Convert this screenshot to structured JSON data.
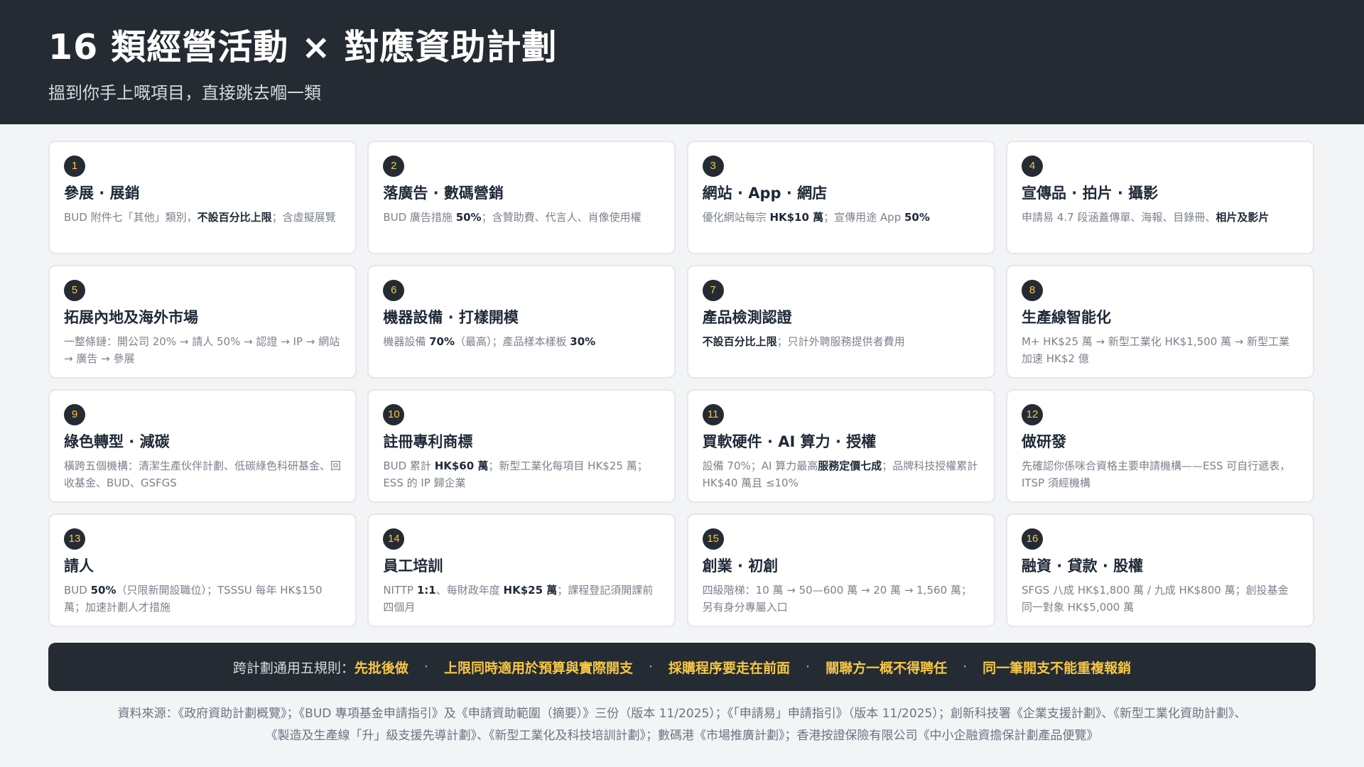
{
  "header": {
    "title": "16 類經營活動 × 對應資助計劃",
    "subtitle": "搵到你手上嘅項目，直接跳去嗰一類"
  },
  "cards": [
    {
      "num": "1",
      "title": "參展 · 展銷",
      "desc": [
        "BUD 附件七「其他」類別，",
        {
          "b": "不設百分比上限"
        },
        "；含虛擬展覽"
      ]
    },
    {
      "num": "2",
      "title": "落廣告 · 數碼營銷",
      "desc": [
        "BUD 廣告措施 ",
        {
          "b": "50%"
        },
        "；含贊助費、代言人、肖像使用權"
      ]
    },
    {
      "num": "3",
      "title": "網站 · App · 網店",
      "desc": [
        "優化網站每宗 ",
        {
          "b": "HK$10 萬"
        },
        "；宣傳用途 App ",
        {
          "b": "50%"
        }
      ]
    },
    {
      "num": "4",
      "title": "宣傳品 · 拍片 · 攝影",
      "desc": [
        "申請易 4.7 段涵蓋傳單、海報、目錄冊、",
        {
          "b": "相片及影片"
        }
      ]
    },
    {
      "num": "5",
      "title": "拓展內地及海外市場",
      "desc": [
        "一整條鏈：開公司 20% → 請人 50% → 認證 → IP → 網站 → 廣告 → 參展"
      ]
    },
    {
      "num": "6",
      "title": "機器設備 · 打樣開模",
      "desc": [
        "機器設備 ",
        {
          "b": "70%"
        },
        "（最高）；產品樣本樣板 ",
        {
          "b": "30%"
        }
      ]
    },
    {
      "num": "7",
      "title": "產品檢測認證",
      "desc": [
        {
          "b": "不設百分比上限"
        },
        "；只計外聘服務提供者費用"
      ]
    },
    {
      "num": "8",
      "title": "生產線智能化",
      "desc": [
        "M+ HK$25 萬 → 新型工業化 HK$1,500 萬 → 新型工業加速 HK$2 億"
      ]
    },
    {
      "num": "9",
      "title": "綠色轉型 · 減碳",
      "desc": [
        "橫跨五個機構：清潔生產伙伴計劃、低碳綠色科研基金、回收基金、BUD、GSFGS"
      ]
    },
    {
      "num": "10",
      "title": "註冊專利商標",
      "desc": [
        "BUD 累計 ",
        {
          "b": "HK$60 萬"
        },
        "；新型工業化每項目 HK$25 萬；ESS 的 IP 歸企業"
      ]
    },
    {
      "num": "11",
      "title": "買軟硬件 · AI 算力 · 授權",
      "desc": [
        "設備 70%；AI 算力最高",
        {
          "b": "服務定價七成"
        },
        "；品牌科技授權累計 HK$40 萬且 ≤10%"
      ]
    },
    {
      "num": "12",
      "title": "做研發",
      "desc": [
        "先確認你係咪合資格主要申請機構——ESS 可自行遞表，ITSP 須經機構"
      ]
    },
    {
      "num": "13",
      "title": "請人",
      "desc": [
        "BUD ",
        {
          "b": "50%"
        },
        "（只限新開設職位）；TSSSU 每年 HK$150 萬；加速計劃人才措施"
      ]
    },
    {
      "num": "14",
      "title": "員工培訓",
      "desc": [
        "NITTP ",
        {
          "b": "1:1"
        },
        "、每財政年度 ",
        {
          "b": "HK$25 萬"
        },
        "；課程登記須開課前四個月"
      ]
    },
    {
      "num": "15",
      "title": "創業 · 初創",
      "desc": [
        "四級階梯：10 萬 → 50—600 萬 → 20 萬 → 1,560 萬；另有身分專屬入口"
      ]
    },
    {
      "num": "16",
      "title": "融資 · 貸款 · 股權",
      "desc": [
        "SFGS 八成 HK$1,800 萬 / 九成 HK$800 萬；創投基金同一對象 HK$5,000 萬"
      ]
    }
  ],
  "rules": {
    "label": "跨計劃通用五規則：",
    "items": [
      "先批後做",
      "上限同時適用於預算與實際開支",
      "採購程序要走在前面",
      "關聯方一概不得聘任",
      "同一筆開支不能重複報銷"
    ],
    "separator": "·"
  },
  "source": {
    "line1": "資料來源：《政府資助計劃概覽》；《BUD 專項基金申請指引》及《申請資助範圍（摘要）》三份（版本 11/2025）；《「申請易」申請指引》（版本 11/2025）；創新科技署《企業支援計劃》、《新型工業化資助計劃》、",
    "line2": "《製造及生產線「升」級支援先導計劃》、《新型工業化及科技培訓計劃》；數碼港《市場推廣計劃》；香港按證保險有限公司《中小企融資擔保計劃產品便覽》"
  },
  "colors": {
    "dark": "#252b33",
    "accent": "#f6c744",
    "background": "#f3f4f6"
  }
}
